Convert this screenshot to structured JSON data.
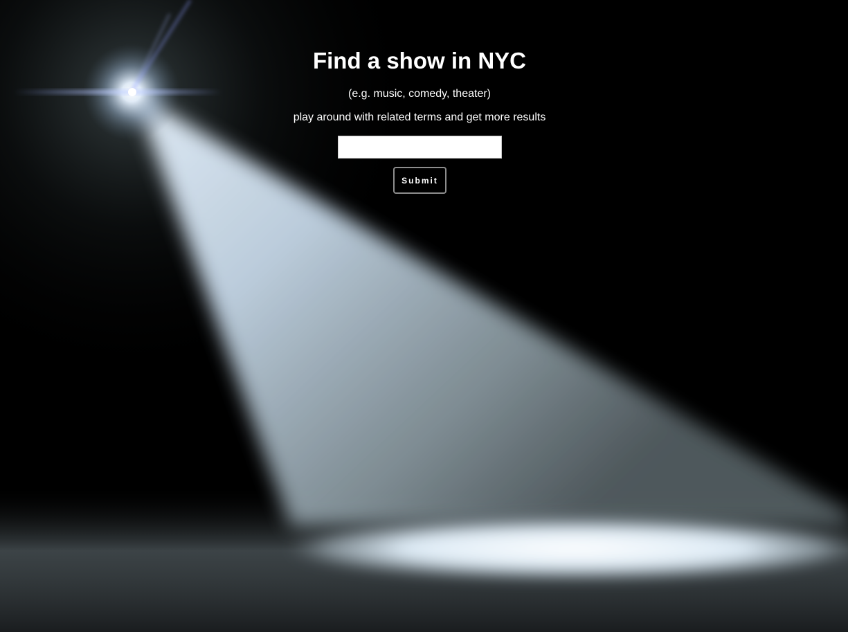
{
  "page": {
    "title": "Find a show in NYC",
    "hint": "(e.g. music, comedy, theater)",
    "subhint": "play around with related terms and get more results"
  },
  "search": {
    "value": "",
    "placeholder": ""
  },
  "submit": {
    "label": "Submit"
  },
  "colors": {
    "background": "#000000",
    "text": "#ffffff",
    "beam": "#cfe3f5",
    "button_border": "#8d8d8d"
  },
  "icons": {
    "background": "spotlight-illustration"
  }
}
